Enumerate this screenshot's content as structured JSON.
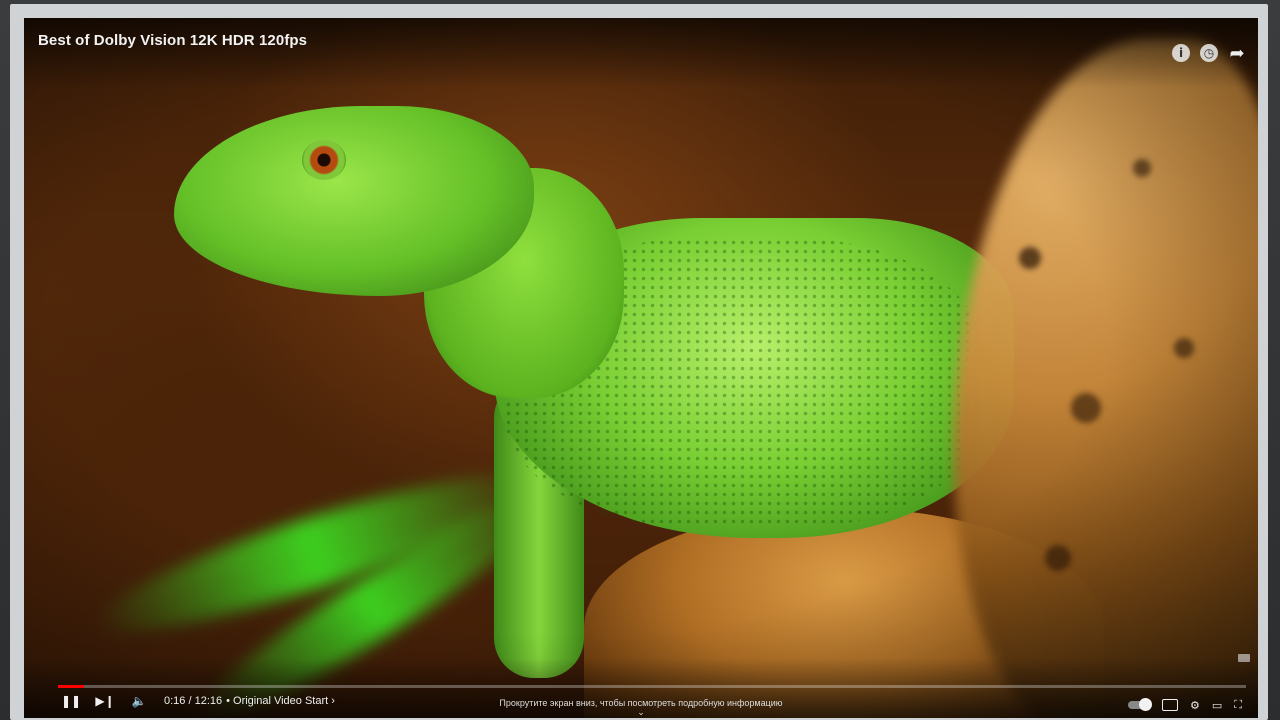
{
  "video": {
    "title": "Best of Dolby Vision 12K HDR 120fps",
    "current_time": "0:16",
    "duration": "12:16",
    "time_display": "0:16 / 12:16",
    "chapter_label": "• Original Video Start ›",
    "progress_fraction": 0.022,
    "scroll_hint": "Прокрутите экран вниз, чтобы посмотреть подробную информацию"
  },
  "icons": {
    "info": "info-icon",
    "watch_later": "clock-icon",
    "share": "share-icon",
    "play_pause": "pause-icon",
    "next": "next-icon",
    "volume": "volume-icon",
    "autoplay": "autoplay-toggle",
    "subtitles": "subtitles-icon",
    "settings": "settings-icon",
    "cast": "cast-icon",
    "fullscreen": "fullscreen-icon"
  },
  "glyphs": {
    "info": "i",
    "clock": "◷",
    "share": "➦",
    "pause": "❚❚",
    "next": "▶❙",
    "volume": "🔈",
    "chevron": "⌄",
    "settings": "⚙",
    "cast": "▭",
    "fullscreen": "⛶"
  },
  "colors": {
    "progress": "#ff0000",
    "text": "#f2f2f2"
  }
}
